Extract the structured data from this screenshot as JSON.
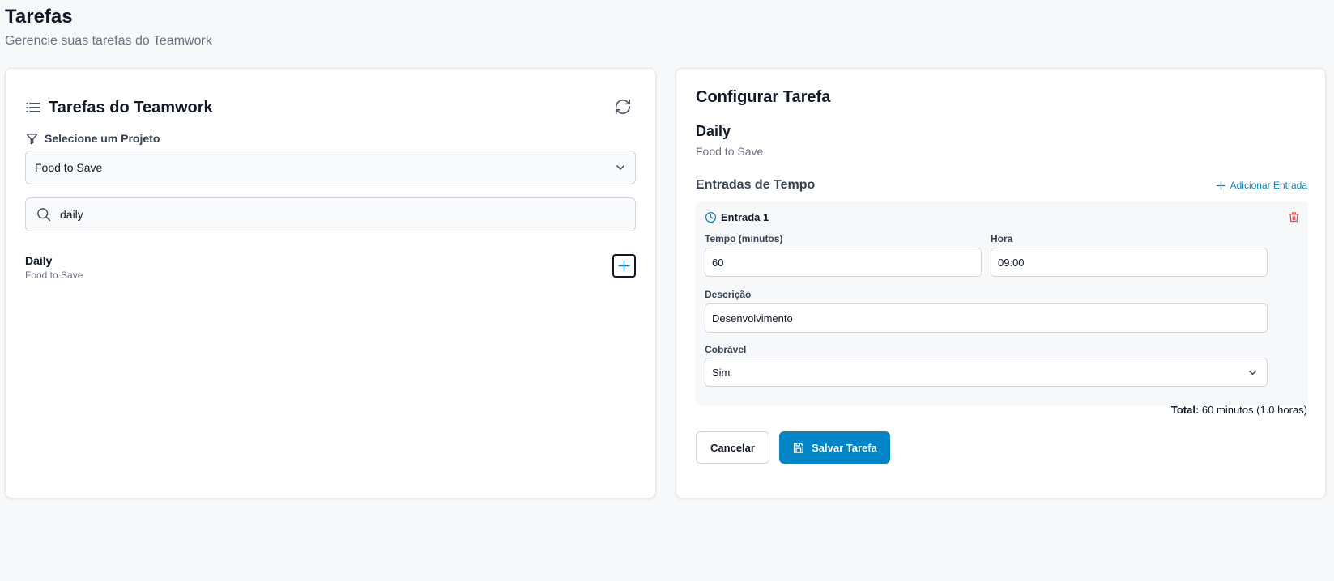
{
  "page": {
    "title": "Tarefas",
    "subtitle": "Gerencie suas tarefas do Teamwork"
  },
  "task_list": {
    "title": "Tarefas do Teamwork",
    "project_filter_label": "Selecione um Projeto",
    "selected_project": "Food to Save",
    "search_value": "daily",
    "items": [
      {
        "name": "Daily",
        "project": "Food to Save"
      }
    ]
  },
  "config": {
    "title": "Configurar Tarefa",
    "task_name": "Daily",
    "task_project": "Food to Save",
    "entries_title": "Entradas de Tempo",
    "add_entry_label": "Adicionar Entrada",
    "entries": [
      {
        "title": "Entrada 1",
        "time_label": "Tempo (minutos)",
        "time_value": "60",
        "hour_label": "Hora",
        "hour_value": "09:00",
        "description_label": "Descrição",
        "description_value": "Desenvolvimento",
        "billable_label": "Cobrável",
        "billable_value": "Sim"
      }
    ],
    "total_label": "Total:",
    "total_value": "60 minutos (1.0 horas)",
    "cancel_label": "Cancelar",
    "save_label": "Salvar Tarefa"
  },
  "colors": {
    "accent": "#0284c7",
    "danger": "#ef4444",
    "background": "#f7f8fa"
  },
  "icons": {
    "list": "list-icon",
    "refresh": "refresh-icon",
    "filter": "filter-icon",
    "search": "search-icon",
    "add": "plus-icon",
    "clock": "clock-icon",
    "delete": "trash-icon",
    "save": "save-icon"
  }
}
